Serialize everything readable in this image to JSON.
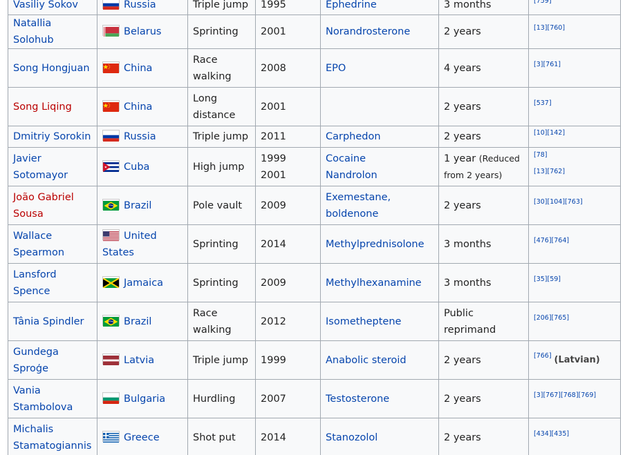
{
  "rows": [
    {
      "athlete": "Vasiliy Sokov",
      "athlete_link": "blue",
      "country": "Russia",
      "flag": "russia",
      "event": "Triple jump",
      "year": "1995",
      "substance": "Ephedrine",
      "sanction": "3 months",
      "refs": "[759]"
    },
    {
      "athlete": "Natallia Solohub",
      "athlete_link": "blue",
      "country": "Belarus",
      "flag": "belarus",
      "event": "Sprinting",
      "year": "2001",
      "substance": "Norandrosterone",
      "sanction": "2 years",
      "refs": "[13][760]"
    },
    {
      "athlete": "Song Hongjuan",
      "athlete_link": "blue",
      "country": "China",
      "flag": "china",
      "event": "Race walking",
      "year": "2008",
      "substance": "EPO",
      "sanction": "4 years",
      "refs": "[3][761]"
    },
    {
      "athlete": "Song Liqing",
      "athlete_link": "red",
      "country": "China",
      "flag": "china",
      "event": "Long distance",
      "year": "2001",
      "substance": "",
      "sanction": "2 years",
      "refs": "[537]"
    },
    {
      "athlete": "Dmitriy Sorokin",
      "athlete_link": "blue",
      "country": "Russia",
      "flag": "russia",
      "event": "Triple jump",
      "year": "2011",
      "substance": "Carphedon",
      "sanction": "2 years",
      "refs": "[10][142]"
    },
    {
      "athlete": "Javier Sotomayor",
      "athlete_link": "blue",
      "country": "Cuba",
      "flag": "cuba",
      "event": "High jump",
      "year": "1999",
      "year2": "2001",
      "substance": "Cocaine",
      "substance2": "Nandrolon",
      "sanction": "1 year",
      "sanction_note": "(Reduced from 2 years)",
      "refs": "[78]",
      "refs2": "[13][762]"
    },
    {
      "athlete": "João Gabriel Sousa",
      "athlete_link": "red",
      "country": "Brazil",
      "flag": "brazil",
      "event": "Pole vault",
      "year": "2009",
      "substance": "Exemestane, boldenone",
      "sanction": "2 years",
      "refs": "[30][104][763]"
    },
    {
      "athlete": "Wallace Spearmon",
      "athlete_link": "blue",
      "country": "United States",
      "flag": "usa",
      "event": "Sprinting",
      "year": "2014",
      "substance": "Methylprednisolone",
      "sanction": "3 months",
      "refs": "[476][764]"
    },
    {
      "athlete": "Lansford Spence",
      "athlete_link": "blue",
      "country": "Jamaica",
      "flag": "jamaica",
      "event": "Sprinting",
      "year": "2009",
      "substance": "Methylhexanamine",
      "sanction": "3 months",
      "refs": "[35][59]"
    },
    {
      "athlete": "Tânia Spindler",
      "athlete_link": "blue",
      "country": "Brazil",
      "flag": "brazil",
      "event": "Race walking",
      "year": "2012",
      "substance": "Isometheptene",
      "sanction": "Public reprimand",
      "refs": "[206][765]"
    },
    {
      "athlete": "Gundega Sproģe",
      "athlete_link": "blue",
      "country": "Latvia",
      "flag": "latvia",
      "event": "Triple jump",
      "year": "1999",
      "substance": "Anabolic steroid",
      "sanction": "2 years",
      "refs": "[766]",
      "ref_note": "(Latvian)"
    },
    {
      "athlete": "Vania Stambolova",
      "athlete_link": "blue",
      "country": "Bulgaria",
      "flag": "bulgaria",
      "event": "Hurdling",
      "year": "2007",
      "substance": "Testosterone",
      "sanction": "2 years",
      "refs": "[3][767][768][769]"
    },
    {
      "athlete": "Michalis Stamatogiannis",
      "athlete_link": "blue",
      "country": "Greece",
      "flag": "greece",
      "event": "Shot put",
      "year": "2014",
      "substance": "Stanozolol",
      "sanction": "2 years",
      "refs": "[434][435]"
    }
  ],
  "colors": {
    "link": "#0645ad",
    "redlink": "#ba0000",
    "border": "#a2a9b1",
    "background": "#f8f9fa"
  }
}
